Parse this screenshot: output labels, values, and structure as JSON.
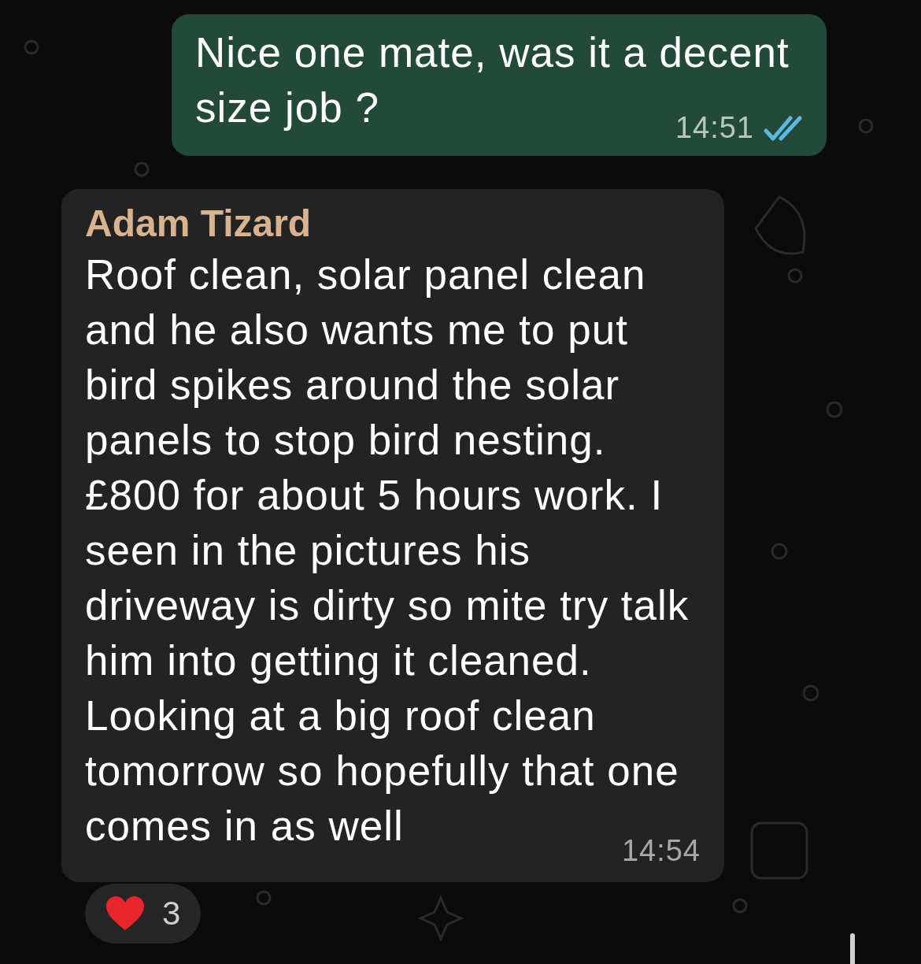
{
  "messages": [
    {
      "kind": "outgoing",
      "lines": [
        "Nice one mate, was it a decent",
        "size job ?"
      ],
      "time": "14:51",
      "read": true
    },
    {
      "kind": "incoming",
      "sender": "Adam Tizard",
      "lines": [
        "Roof clean, solar panel clean",
        "and he also wants me to put",
        "bird spikes around the solar",
        "panels to stop bird nesting.",
        "£800 for about 5 hours work. I",
        "seen in the pictures his",
        "driveway is dirty so mite try talk",
        "him into getting it cleaned.",
        "Looking at a big roof clean",
        "tomorrow so hopefully that one",
        "comes in as well"
      ],
      "time": "14:54",
      "reaction": {
        "count": "3"
      }
    }
  ]
}
